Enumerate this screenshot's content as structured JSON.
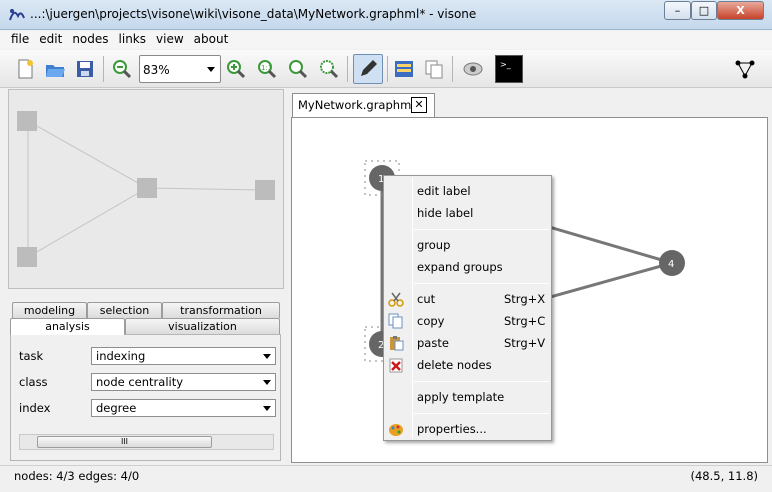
{
  "window": {
    "title": "...:\\juergen\\projects\\visone\\wiki\\visone_data\\MyNetwork.graphml* - visone",
    "minimize": "–",
    "maximize": "□",
    "close": "X"
  },
  "menu": [
    "file",
    "edit",
    "nodes",
    "links",
    "view",
    "about"
  ],
  "toolbar": {
    "zoom_value": "83%",
    "icons": [
      "new-file-icon",
      "open-folder-icon",
      "save-disk-icon",
      "zoom-out-icon",
      "zoom-in-icon",
      "zoom-actual-icon",
      "zoom-fit-icon",
      "zoom-selection-icon",
      "pen-edit-icon",
      "properties-list-icon",
      "copy-template-icon",
      "eye-icon",
      "console-icon",
      "network-triangle-icon"
    ]
  },
  "left": {
    "tabs_row1": [
      "modeling",
      "selection",
      "transformation"
    ],
    "tabs_row2": [
      "analysis",
      "visualization"
    ],
    "active_tab": "analysis",
    "fields": [
      {
        "label": "task",
        "value": "indexing"
      },
      {
        "label": "class",
        "value": "node centrality"
      },
      {
        "label": "index",
        "value": "degree"
      }
    ],
    "scroll_thumb": "III"
  },
  "document": {
    "tab_label": "MyNetwork.graphml*",
    "tab_close": "✕"
  },
  "graph": {
    "nodes": [
      {
        "id": "1",
        "label": "1"
      },
      {
        "id": "2",
        "label": "2"
      },
      {
        "id": "4",
        "label": "4"
      }
    ]
  },
  "context_menu": {
    "items": [
      {
        "label": "edit label",
        "shortcut": "",
        "icon": ""
      },
      {
        "label": "hide label",
        "shortcut": "",
        "icon": ""
      },
      {
        "label": "group",
        "shortcut": "",
        "icon": ""
      },
      {
        "label": "expand groups",
        "shortcut": "",
        "icon": ""
      },
      {
        "label": "cut",
        "shortcut": "Strg+X",
        "icon": "scissors-icon"
      },
      {
        "label": "copy",
        "shortcut": "Strg+C",
        "icon": "copy-icon"
      },
      {
        "label": "paste",
        "shortcut": "Strg+V",
        "icon": "paste-icon"
      },
      {
        "label": "delete nodes",
        "shortcut": "",
        "icon": "delete-icon"
      },
      {
        "label": "apply template",
        "shortcut": "",
        "icon": ""
      },
      {
        "label": "properties...",
        "shortcut": "",
        "icon": "properties-icon"
      }
    ]
  },
  "status": {
    "counts": "nodes: 4/3 edges: 4/0",
    "coords": "(48.5, 11.8)"
  },
  "colors": {
    "node_fill": "#666666",
    "overview_node": "#bcbcbc",
    "title_gradient": "#c5d8ec"
  }
}
